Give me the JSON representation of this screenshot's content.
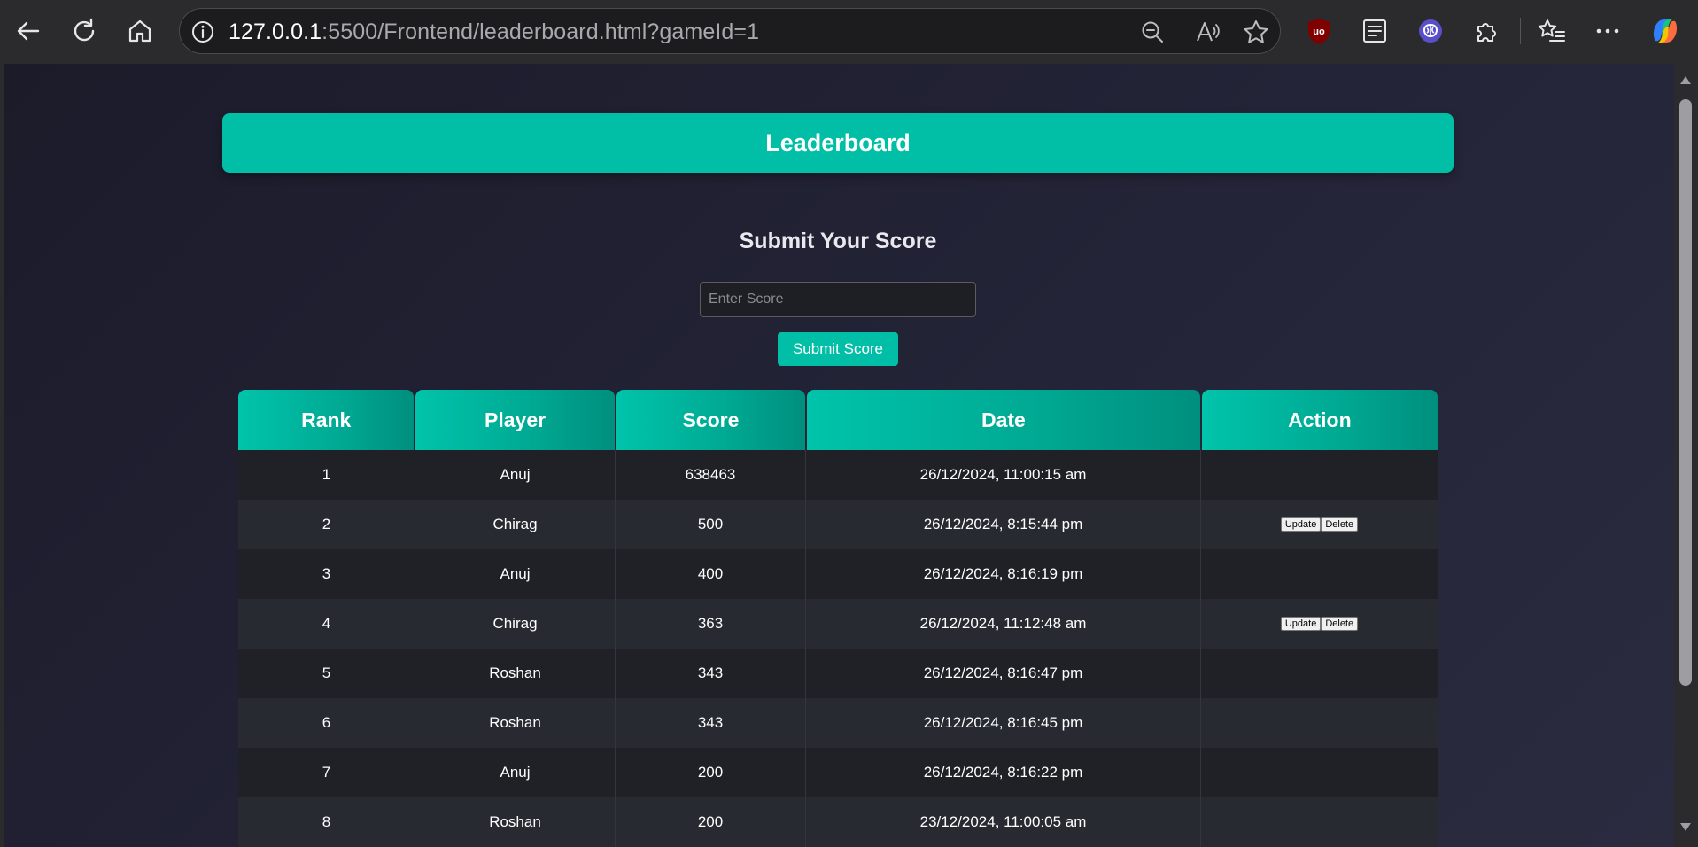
{
  "browser": {
    "url_host": "127.0.0.1",
    "url_rest": ":5500/Frontend/leaderboard.html?gameId=1"
  },
  "page": {
    "banner_title": "Leaderboard",
    "submit_title": "Submit Your Score",
    "score_placeholder": "Enter Score",
    "score_value": "",
    "submit_label": "Submit Score"
  },
  "table": {
    "headers": [
      "Rank",
      "Player",
      "Score",
      "Date",
      "Action"
    ],
    "rows": [
      {
        "rank": "1",
        "player": "Anuj",
        "score": "638463",
        "date": "26/12/2024, 11:00:15 am",
        "actions": []
      },
      {
        "rank": "2",
        "player": "Chirag",
        "score": "500",
        "date": "26/12/2024, 8:15:44 pm",
        "actions": [
          "Update",
          "Delete"
        ]
      },
      {
        "rank": "3",
        "player": "Anuj",
        "score": "400",
        "date": "26/12/2024, 8:16:19 pm",
        "actions": []
      },
      {
        "rank": "4",
        "player": "Chirag",
        "score": "363",
        "date": "26/12/2024, 11:12:48 am",
        "actions": [
          "Update",
          "Delete"
        ]
      },
      {
        "rank": "5",
        "player": "Roshan",
        "score": "343",
        "date": "26/12/2024, 8:16:47 pm",
        "actions": []
      },
      {
        "rank": "6",
        "player": "Roshan",
        "score": "343",
        "date": "26/12/2024, 8:16:45 pm",
        "actions": []
      },
      {
        "rank": "7",
        "player": "Anuj",
        "score": "200",
        "date": "26/12/2024, 8:16:22 pm",
        "actions": []
      },
      {
        "rank": "8",
        "player": "Roshan",
        "score": "200",
        "date": "23/12/2024, 11:00:05 am",
        "actions": []
      }
    ]
  },
  "colors": {
    "accent": "#00bfa6",
    "row_dark": "#1f2126",
    "row_light": "#272a31",
    "page_bg": "#242438"
  },
  "icons": {
    "toolbar": [
      "back-icon",
      "refresh-icon",
      "home-icon",
      "info-icon",
      "zoom-out-icon",
      "read-aloud-icon",
      "favorite-star-icon",
      "ublock-icon",
      "reading-view-icon",
      "brain-extension-icon",
      "extensions-puzzle-icon",
      "favorites-list-icon",
      "more-menu-icon",
      "copilot-icon"
    ]
  }
}
